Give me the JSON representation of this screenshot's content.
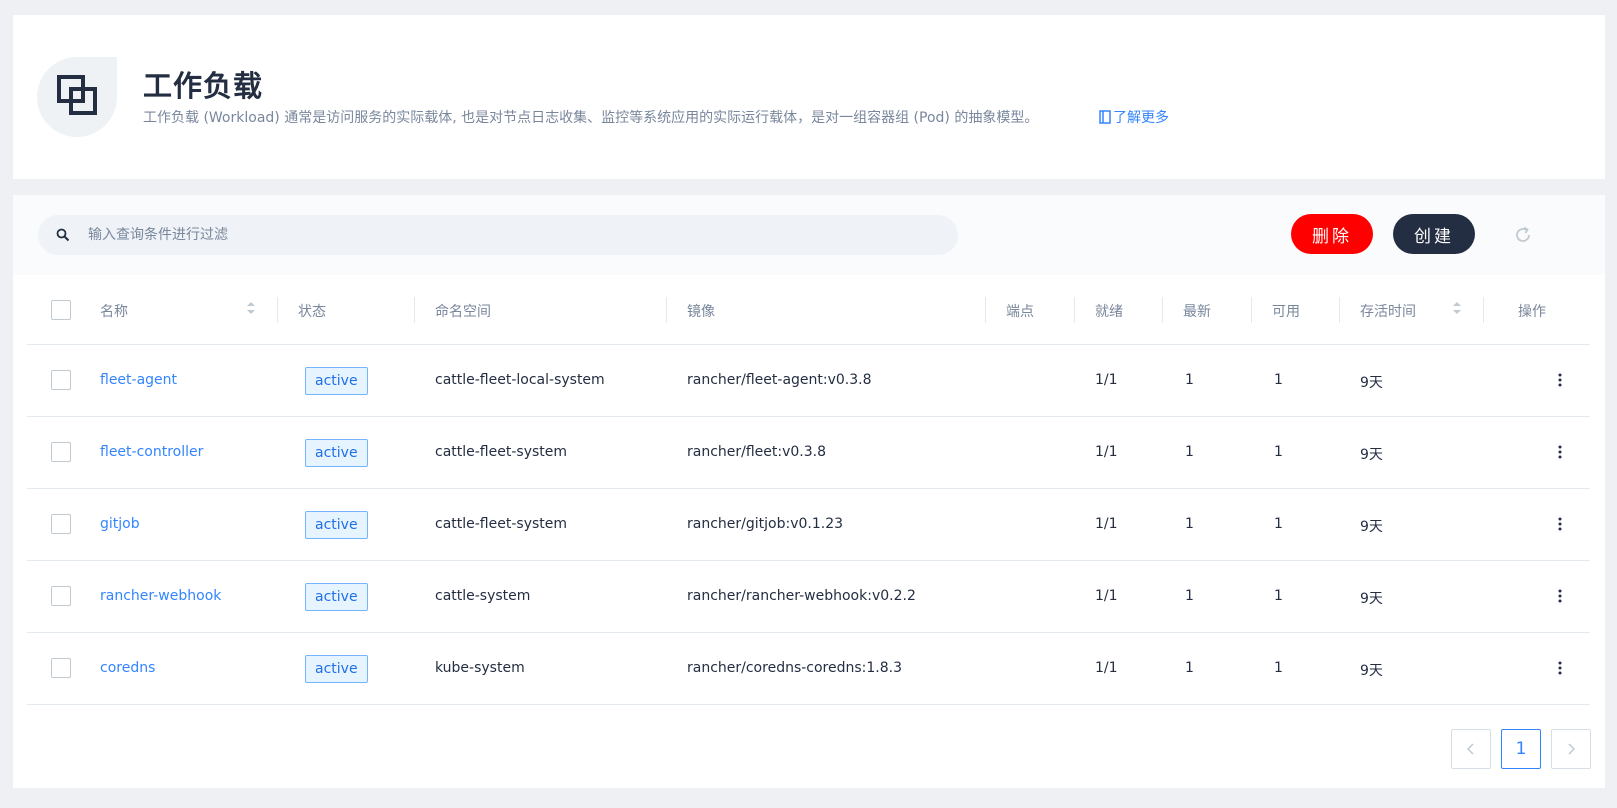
{
  "header": {
    "title": "工作负载",
    "description": "工作负载 (Workload) 通常是访问服务的实际载体, 也是对节点日志收集、监控等系统应用的实际运行载体，是对一组容器组 (Pod) 的抽象模型。",
    "learn_more": "了解更多",
    "icon": "workload-icon"
  },
  "toolbar": {
    "search_placeholder": "输入查询条件进行过滤",
    "delete_label": "删除",
    "create_label": "创建",
    "delete_color": "#ff0000",
    "create_color": "#242e42"
  },
  "table": {
    "columns": [
      "名称",
      "状态",
      "命名空间",
      "镜像",
      "端点",
      "就绪",
      "最新",
      "可用",
      "存活时间",
      "操作"
    ],
    "rows": [
      {
        "name": "fleet-agent",
        "status": "active",
        "namespace": "cattle-fleet-local-system",
        "image": "rancher/fleet-agent:v0.3.8",
        "endpoint": "",
        "ready": "1/1",
        "latest": "1",
        "available": "1",
        "age": "9天"
      },
      {
        "name": "fleet-controller",
        "status": "active",
        "namespace": "cattle-fleet-system",
        "image": "rancher/fleet:v0.3.8",
        "endpoint": "",
        "ready": "1/1",
        "latest": "1",
        "available": "1",
        "age": "9天"
      },
      {
        "name": "gitjob",
        "status": "active",
        "namespace": "cattle-fleet-system",
        "image": "rancher/gitjob:v0.1.23",
        "endpoint": "",
        "ready": "1/1",
        "latest": "1",
        "available": "1",
        "age": "9天"
      },
      {
        "name": "rancher-webhook",
        "status": "active",
        "namespace": "cattle-system",
        "image": "rancher/rancher-webhook:v0.2.2",
        "endpoint": "",
        "ready": "1/1",
        "latest": "1",
        "available": "1",
        "age": "9天"
      },
      {
        "name": "coredns",
        "status": "active",
        "namespace": "kube-system",
        "image": "rancher/coredns-coredns:1.8.3",
        "endpoint": "",
        "ready": "1/1",
        "latest": "1",
        "available": "1",
        "age": "9天"
      }
    ]
  },
  "pagination": {
    "current_page": "1"
  }
}
